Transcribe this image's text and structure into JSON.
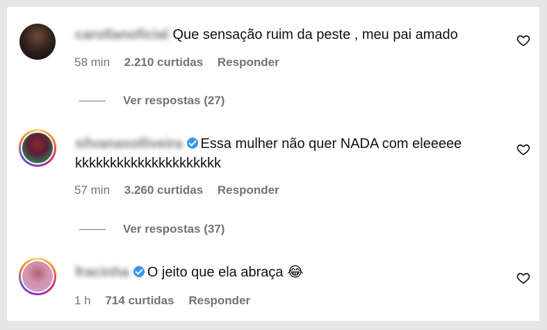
{
  "comments": [
    {
      "username": "carollanoficial",
      "verified": false,
      "text": "Que sensação ruim da peste , meu pai amado",
      "text2": "",
      "time": "58 min",
      "likes": "2.210 curtidas",
      "reply": "Responder",
      "view_replies": "Ver respostas (27)"
    },
    {
      "username": "silvanasolliveira",
      "verified": true,
      "text": "Essa mulher não quer NADA com eleeeee",
      "text2": "kkkkkkkkkkkkkkkkkkkkk",
      "time": "57 min",
      "likes": "3.260 curtidas",
      "reply": "Responder",
      "view_replies": "Ver respostas (37)"
    },
    {
      "username": "fracinha",
      "verified": true,
      "text": "O jeito que ela abraça",
      "emoji": "😂",
      "time": "1 h",
      "likes": "714 curtidas",
      "reply": "Responder"
    }
  ],
  "icons": {
    "like": "heart-outline-icon",
    "verified": "verified-badge-icon"
  },
  "colors": {
    "verified": "#3897f0",
    "muted": "#737373",
    "background": "#ffffff"
  }
}
